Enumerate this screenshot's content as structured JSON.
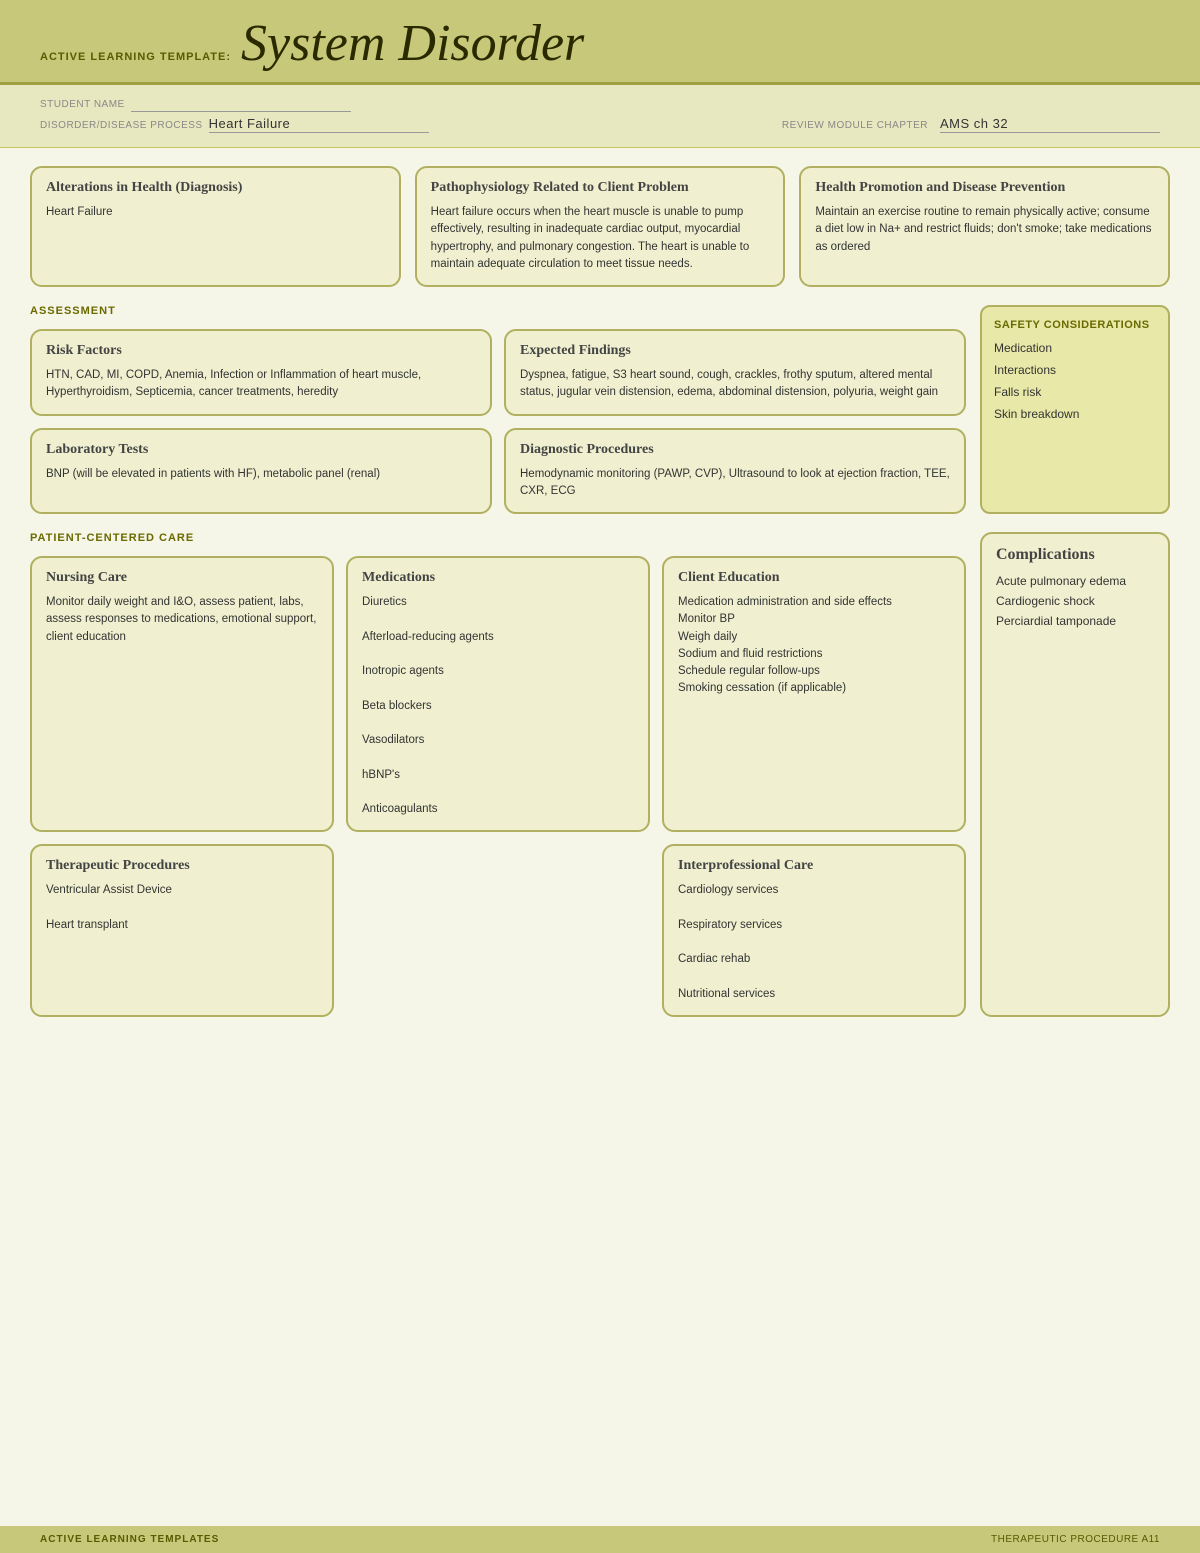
{
  "header": {
    "label": "ACTIVE LEARNING TEMPLATE:",
    "title": "System Disorder"
  },
  "student_info": {
    "student_name_label": "STUDENT NAME",
    "disorder_label": "DISORDER/DISEASE PROCESS",
    "disorder_value": "Heart Failure",
    "review_label": "REVIEW MODULE CHAPTER",
    "review_value": "AMS ch 32"
  },
  "top_boxes": [
    {
      "title": "Alterations in Health (Diagnosis)",
      "text": "Heart Failure"
    },
    {
      "title": "Pathophysiology Related to Client Problem",
      "text": "Heart failure occurs when the heart muscle is unable to pump effectively, resulting in inadequate cardiac output, myocardial hypertrophy, and pulmonary congestion. The heart is unable to maintain adequate circulation to meet tissue needs."
    },
    {
      "title": "Health Promotion and Disease Prevention",
      "text": "Maintain an exercise routine to remain physically active; consume a diet low in Na+ and restrict fluids; don't smoke; take medications as ordered"
    }
  ],
  "assessment": {
    "section_label": "ASSESSMENT",
    "cards": [
      {
        "title": "Risk Factors",
        "text": "HTN, CAD, MI, COPD, Anemia, Infection or Inflammation of heart muscle, Hyperthyroidism, Septicemia, cancer treatments, heredity"
      },
      {
        "title": "Expected Findings",
        "text": "Dyspnea, fatigue, S3 heart sound, cough, crackles, frothy sputum, altered mental status, jugular vein distension, edema, abdominal distension, polyuria, weight gain"
      },
      {
        "title": "Laboratory Tests",
        "text": "BNP (will be elevated in patients with HF), metabolic panel (renal)"
      },
      {
        "title": "Diagnostic Procedures",
        "text": "Hemodynamic monitoring (PAWP, CVP), Ultrasound to look at ejection fraction, TEE, CXR, ECG"
      }
    ]
  },
  "safety": {
    "title": "SAFETY CONSIDERATIONS",
    "items": [
      "Medication",
      "Interactions",
      "Falls risk",
      "Skin breakdown"
    ]
  },
  "patient_care": {
    "section_label": "PATIENT-CENTERED CARE",
    "top_cards": [
      {
        "title": "Nursing Care",
        "text": "Monitor daily weight and I&O, assess patient, labs, assess responses to medications, emotional support, client education"
      },
      {
        "title": "Medications",
        "text": "Diuretics\n\nAfterload-reducing agents\n\nInotropic agents\n\nBeta blockers\n\nVasodilators\n\nhBNP's\n\nAnticoagulants"
      },
      {
        "title": "Client Education",
        "text": "Medication administration and side effects\nMonitor BP\nWeigh daily\nSodium and fluid restrictions\nSchedule regular follow-ups\nSmoking cessation (if applicable)"
      }
    ],
    "bottom_cards": [
      {
        "title": "Therapeutic Procedures",
        "text": "Ventricular Assist Device\n\nHeart transplant"
      },
      {
        "title": "",
        "text": ""
      },
      {
        "title": "Interprofessional Care",
        "text": "Cardiology services\n\nRespiratory services\n\nCardiac rehab\n\nNutritional services"
      }
    ]
  },
  "complications": {
    "title": "Complications",
    "items": [
      "Acute pulmonary edema",
      "Cardiogenic shock",
      "Perciardial tamponade"
    ]
  },
  "footer": {
    "left": "ACTIVE LEARNING TEMPLATES",
    "right": "THERAPEUTIC PROCEDURE  A11"
  }
}
